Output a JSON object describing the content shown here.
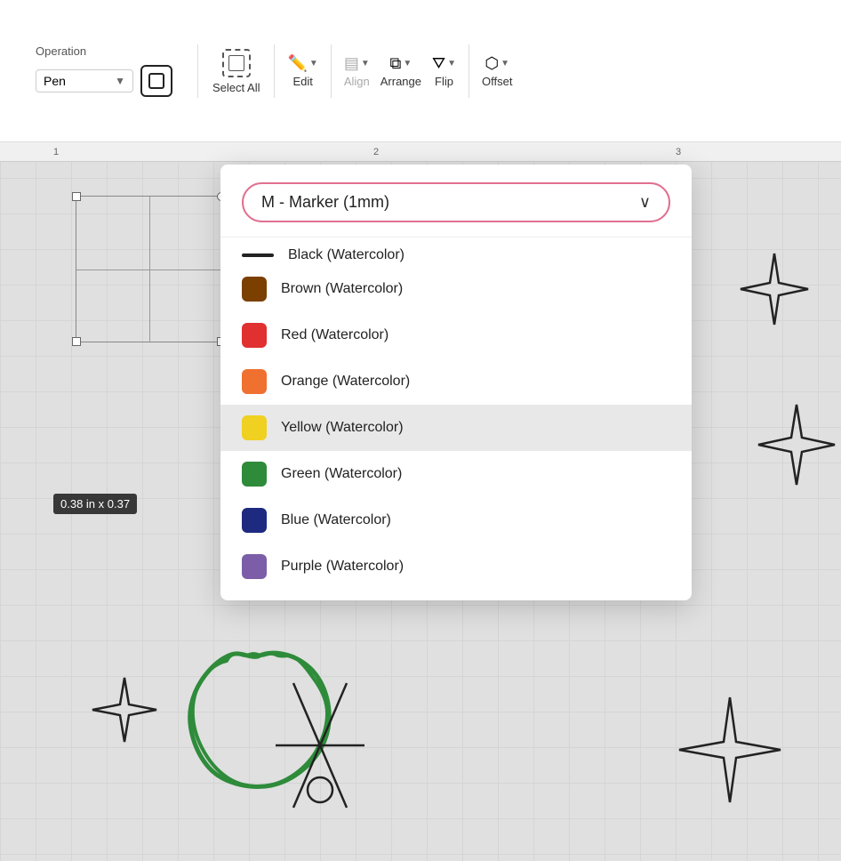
{
  "toolbar": {
    "operation_label": "Operation",
    "pen_value": "Pen",
    "select_all_label": "Select All",
    "edit_label": "Edit",
    "align_label": "Align",
    "arrange_label": "Arrange",
    "flip_label": "Flip",
    "offset_label": "Offset"
  },
  "canvas": {
    "size_badge": "0.38  in x 0.37",
    "ruler_numbers": [
      "1",
      "2",
      "3"
    ]
  },
  "dropdown": {
    "selected_value": "M - Marker (1mm)",
    "chevron": "∨",
    "items": [
      {
        "id": "black",
        "label": "Black (Watercolor)",
        "color": "#111111",
        "visible": "partial"
      },
      {
        "id": "brown",
        "label": "Brown (Watercolor)",
        "color": "#7B3F00"
      },
      {
        "id": "red",
        "label": "Red (Watercolor)",
        "color": "#E03030"
      },
      {
        "id": "orange",
        "label": "Orange (Watercolor)",
        "color": "#F07030"
      },
      {
        "id": "yellow",
        "label": "Yellow (Watercolor)",
        "color": "#F0D020",
        "selected": true
      },
      {
        "id": "green",
        "label": "Green (Watercolor)",
        "color": "#2E8B3A"
      },
      {
        "id": "blue",
        "label": "Blue (Watercolor)",
        "color": "#1E2A80"
      },
      {
        "id": "purple",
        "label": "Purple (Watercolor)",
        "color": "#7B5EA7"
      }
    ]
  }
}
